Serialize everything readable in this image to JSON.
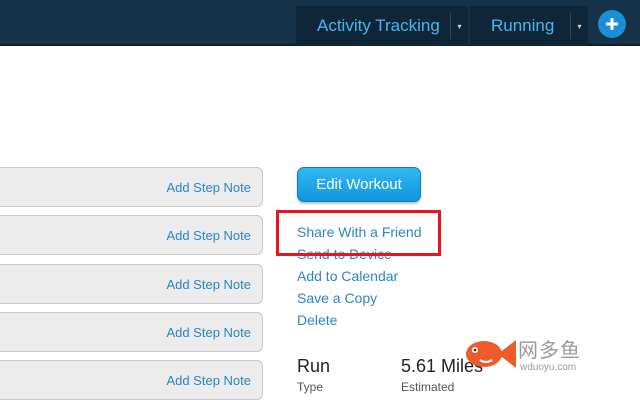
{
  "header": {
    "nav": [
      {
        "label": "Activity Tracking"
      },
      {
        "label": "Running"
      }
    ],
    "caret_glyph": "▾",
    "plus_icon": "plus-icon",
    "accent": "#46b6f0",
    "background": "#163248"
  },
  "steps": [
    {
      "note_label": "Add Step Note"
    },
    {
      "note_label": "Add Step Note"
    },
    {
      "note_label": "Add Step Note"
    },
    {
      "note_label": "Add Step Note"
    },
    {
      "note_label": "Add Step Note"
    }
  ],
  "actions": {
    "edit_button": "Edit Workout",
    "links": [
      {
        "label": "Share With a Friend"
      },
      {
        "label": "Send to Device"
      },
      {
        "label": "Add to Calendar"
      },
      {
        "label": "Save a Copy"
      },
      {
        "label": "Delete"
      }
    ],
    "highlight_color": "#e8141e"
  },
  "stats": [
    {
      "value": "Run",
      "label": "Type"
    },
    {
      "value": "5.61 Miles",
      "label": "Estimated"
    }
  ],
  "watermark": {
    "text": "网多鱼",
    "subtext": "wduoyu.com"
  }
}
